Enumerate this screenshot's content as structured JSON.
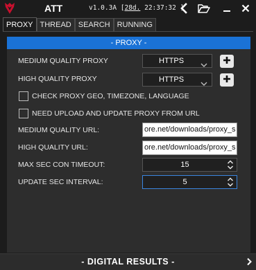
{
  "app": {
    "title": "ATT",
    "version_prefix": "v1.0.3A [",
    "version_days": "28d.",
    "version_suffix": " 22:37:32 ]"
  },
  "titlebar_icons": [
    "logo-icon",
    "back-arrow-icon",
    "folder-icon",
    "minimize-icon",
    "close-icon"
  ],
  "tabs": [
    {
      "label": "PROXY",
      "active": true
    },
    {
      "label": "THREAD",
      "active": false
    },
    {
      "label": "SEARCH",
      "active": false
    },
    {
      "label": "RUNNING",
      "active": false
    }
  ],
  "section": {
    "header": "- PROXY -"
  },
  "proxy": {
    "medium_label": "MEDIUM QUALITY PROXY",
    "medium_value": "HTTPS",
    "high_label": "HIGH QUALITY PROXY",
    "high_value": "HTTPS",
    "check_geo_label": "CHECK PROXY GEO, TIMEZONE, LANGUAGE",
    "check_geo_checked": false,
    "need_upload_label": "NEED UPLOAD AND UPDATE PROXY FROM URL",
    "need_upload_checked": false,
    "medium_url_label": "MEDIUM QUALITY URL:",
    "medium_url_value": "ore.net/downloads/proxy_s",
    "high_url_label": "HIGH QUALITY URL:",
    "high_url_value": "ore.net/downloads/proxy_s",
    "timeout_label": "MAX SEC CON TIMEOUT:",
    "timeout_value": "15",
    "interval_label": "UPDATE SEC INTERVAL:",
    "interval_value": "5"
  },
  "footer": {
    "text": "- DIGITAL RESULTS -"
  },
  "colors": {
    "background": "#1c1c1c",
    "panel": "#2d2d2d",
    "accent": "#1a72d6",
    "logo": "#c8102e"
  }
}
